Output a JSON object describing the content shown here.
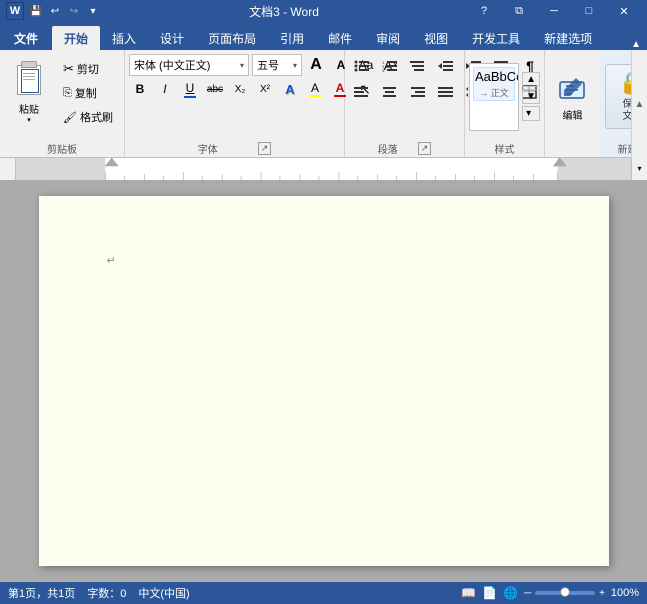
{
  "titleBar": {
    "title": "文档3 - Word",
    "helpBtn": "?",
    "restoreBtn": "⧉",
    "minimizeBtn": "─",
    "maximizeBtn": "□",
    "closeBtn": "✕"
  },
  "quickAccess": {
    "save": "💾",
    "undo": "↩",
    "redo": "↪",
    "customize": "▾"
  },
  "ribbonTabs": {
    "tabs": [
      "文件",
      "开始",
      "插入",
      "设计",
      "页面布局",
      "引用",
      "邮件",
      "审阅",
      "视图",
      "开发工具",
      "新建选项"
    ],
    "activeTab": "开始",
    "newBuildLabel": "新建选项"
  },
  "groups": {
    "clipboard": {
      "label": "剪贴板",
      "pasteLabel": "粘贴",
      "cutLabel": "剪切",
      "copyLabel": "复制",
      "formatPainterLabel": "格式刷"
    },
    "font": {
      "label": "字体",
      "fontName": "宋体 (中文正文)",
      "fontSize": "五号",
      "boldLabel": "B",
      "italicLabel": "I",
      "underlineLabel": "U",
      "strikeLabel": "abc",
      "subscriptLabel": "X₂",
      "superscriptLabel": "X²",
      "growLabel": "A",
      "shrinkLabel": "A",
      "clearLabel": "A",
      "changeCase": "Aa",
      "highlight": "A",
      "fontColor": "A",
      "textEffect": "A"
    },
    "paragraph": {
      "label": "段落",
      "bulletLabel": "≡",
      "numberedLabel": "≡",
      "multiLabel": "≡",
      "decreaseLabel": "←",
      "increaseLabel": "→",
      "sortLabel": "↕",
      "showHideLabel": "¶",
      "alignLeftLabel": "≡",
      "centerLabel": "≡",
      "alignRightLabel": "≡",
      "justifyLabel": "≡",
      "lineSpacingLabel": "≡",
      "shadingLabel": "▥",
      "borderLabel": "⊞"
    },
    "styles": {
      "label": "样式",
      "editLabel": "编辑"
    },
    "edit": {
      "label": "编辑",
      "editIcon": "✎"
    },
    "protect": {
      "label": "新建组",
      "protectLabel": "保护\n文档",
      "protectIcon": "🔒"
    }
  },
  "ruler": {
    "visible": true
  },
  "document": {
    "content": "",
    "cursorReturn": "↵"
  },
  "statusBar": {
    "pageInfo": "第1页，共1页",
    "wordCount": "字数：0",
    "language": "中文(中国)",
    "viewModes": [
      "阅读版式",
      "页面视图",
      "Web版式"
    ],
    "zoom": "100%"
  }
}
